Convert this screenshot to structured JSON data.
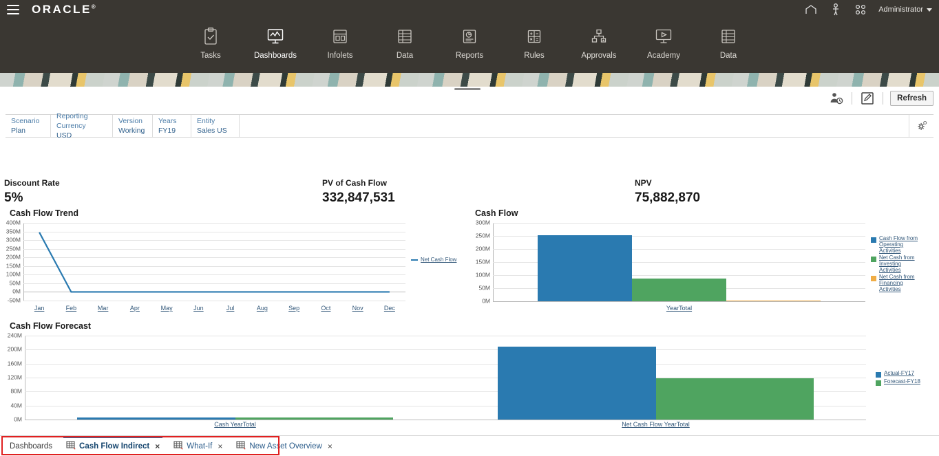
{
  "header": {
    "logo": "ORACLE",
    "menu_icon": "hamburger-icon",
    "user_label": "Administrator",
    "icons": [
      "home-icon",
      "accessibility-icon",
      "apps-grid-icon"
    ]
  },
  "nav": {
    "items": [
      {
        "label": "Tasks",
        "icon": "clipboard-check-icon",
        "active": false
      },
      {
        "label": "Dashboards",
        "icon": "monitor-chart-icon",
        "active": true
      },
      {
        "label": "Infolets",
        "icon": "infolet-panels-icon",
        "active": false
      },
      {
        "label": "Data",
        "icon": "grid-table-icon",
        "active": false
      },
      {
        "label": "Reports",
        "icon": "report-doc-icon",
        "active": false
      },
      {
        "label": "Rules",
        "icon": "calculator-icon",
        "active": false
      },
      {
        "label": "Approvals",
        "icon": "org-hierarchy-icon",
        "active": false
      },
      {
        "label": "Academy",
        "icon": "video-monitor-icon",
        "active": false
      },
      {
        "label": "Data",
        "icon": "grid-table-icon",
        "active": false
      }
    ]
  },
  "toolbar": {
    "user_settings_icon": "user-settings-icon",
    "edit_icon": "edit-pencil-icon",
    "refresh_label": "Refresh"
  },
  "pov": {
    "gear_icon": "settings-gear-icon",
    "cells": [
      {
        "dimension": "Scenario",
        "value": "Plan"
      },
      {
        "dimension": "Reporting Currency",
        "value": "USD"
      },
      {
        "dimension": "Version",
        "value": "Working"
      },
      {
        "dimension": "Years",
        "value": "FY19"
      },
      {
        "dimension": "Entity",
        "value": "Sales US"
      }
    ]
  },
  "kpis": [
    {
      "label": "Discount Rate",
      "value": "5%"
    },
    {
      "label": "PV of Cash Flow",
      "value": "332,847,531"
    },
    {
      "label": "NPV",
      "value": "75,882,870"
    }
  ],
  "colors": {
    "blue": "#2a7ab0",
    "green": "#4fa460",
    "orange": "#f0ad45",
    "header_bg": "#3a3732",
    "tab_accent": "#2b6ca3",
    "highlight_red": "#e02020"
  },
  "chart_data": [
    {
      "type": "line",
      "title": "Cash Flow Trend",
      "xlabel": "",
      "ylabel": "",
      "categories": [
        "Jan",
        "Feb",
        "Mar",
        "Apr",
        "May",
        "Jun",
        "Jul",
        "Aug",
        "Sep",
        "Oct",
        "Nov",
        "Dec"
      ],
      "yticks": [
        "400M",
        "350M",
        "300M",
        "250M",
        "200M",
        "150M",
        "100M",
        "50M",
        "0M",
        "-50M"
      ],
      "ylim": [
        -50000000,
        400000000
      ],
      "grid": true,
      "legend_position": "right",
      "series": [
        {
          "name": "Net Cash Flow",
          "color": "#2a7ab0",
          "values": [
            345000000,
            0,
            0,
            0,
            0,
            0,
            0,
            0,
            0,
            0,
            0,
            0
          ]
        }
      ]
    },
    {
      "type": "bar",
      "title": "Cash Flow",
      "xlabel": "",
      "ylabel": "",
      "categories": [
        "YearTotal"
      ],
      "yticks": [
        "300M",
        "250M",
        "200M",
        "150M",
        "100M",
        "50M",
        "0M"
      ],
      "ylim": [
        0,
        300000000
      ],
      "grid": true,
      "legend_position": "right",
      "series": [
        {
          "name": "Cash Flow from Operating Activities",
          "color": "#2a7ab0",
          "values": [
            253000000
          ]
        },
        {
          "name": "Net Cash from Investing Activities",
          "color": "#4fa460",
          "values": [
            86000000
          ]
        },
        {
          "name": "Net Cash from Financing Activities",
          "color": "#f0ad45",
          "values": [
            3000000
          ]
        }
      ]
    },
    {
      "type": "bar",
      "title": "Cash Flow Forecast",
      "xlabel": "",
      "ylabel": "",
      "categories": [
        "Cash YearTotal",
        "Net Cash Flow YearTotal"
      ],
      "yticks": [
        "240M",
        "200M",
        "160M",
        "120M",
        "80M",
        "40M",
        "0M"
      ],
      "ylim": [
        0,
        240000000
      ],
      "grid": true,
      "legend_position": "right",
      "series": [
        {
          "name": "Actual-FY17",
          "color": "#2a7ab0",
          "values": [
            5000000,
            208000000
          ]
        },
        {
          "name": "Forecast-FY18",
          "color": "#4fa460",
          "values": [
            5000000,
            118000000
          ]
        }
      ]
    }
  ],
  "tabs": [
    {
      "label": "Dashboards",
      "closable": false,
      "active": false,
      "icon": null
    },
    {
      "label": "Cash Flow Indirect",
      "closable": true,
      "active": true,
      "icon": "grid-tab-icon"
    },
    {
      "label": "What-If",
      "closable": true,
      "active": false,
      "icon": "grid-tab-icon"
    },
    {
      "label": "New Asset Overview",
      "closable": true,
      "active": false,
      "icon": "grid-tab-icon"
    }
  ],
  "tab_close_glyph": "×"
}
